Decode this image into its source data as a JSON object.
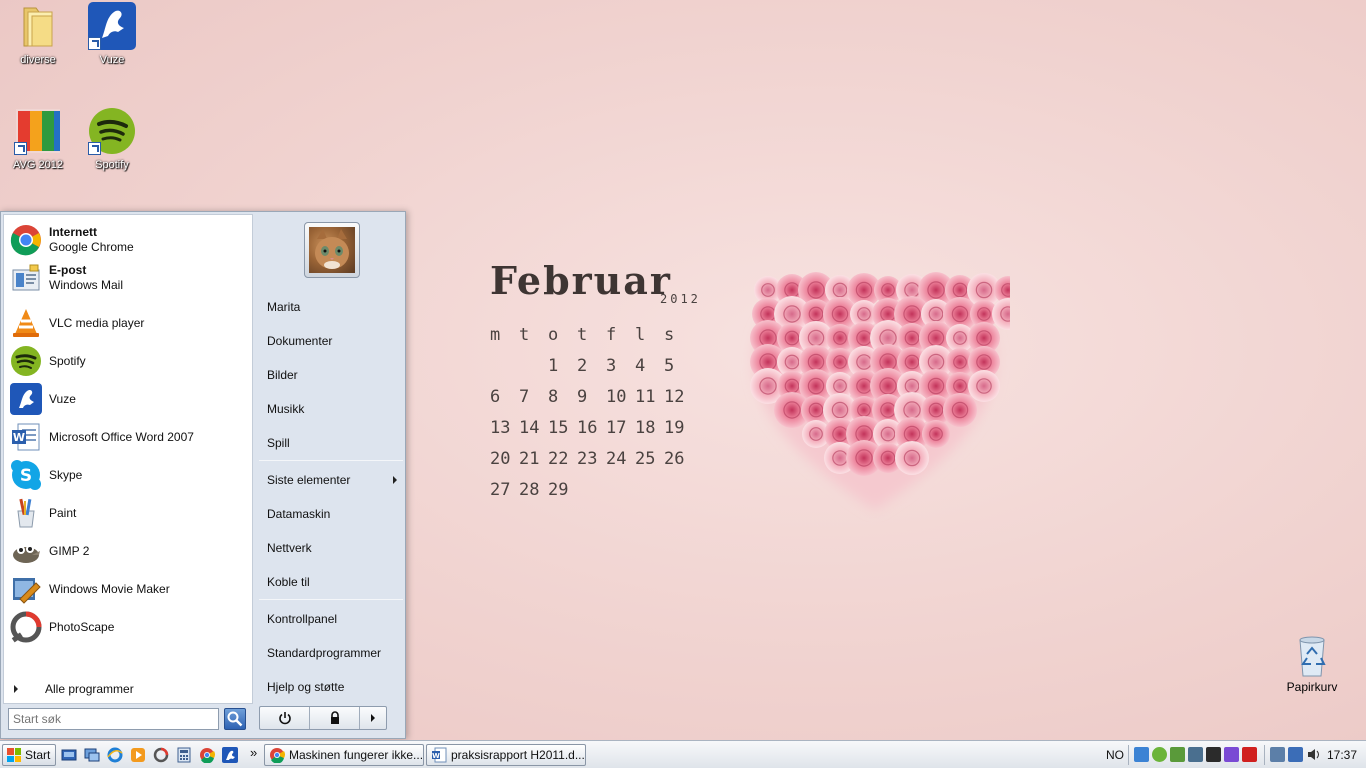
{
  "desktop": {
    "icons": [
      {
        "label": "diverse"
      },
      {
        "label": "Vuze"
      },
      {
        "label": "AVG 2012"
      },
      {
        "label": "Spotify"
      }
    ],
    "recycle_bin": "Papirkurv"
  },
  "wallpaper": {
    "month": "Februar",
    "year": "2012",
    "weekdays": [
      "m",
      "t",
      "o",
      "t",
      "f",
      "l",
      "s"
    ],
    "days": [
      "",
      "",
      "1",
      "2",
      "3",
      "4",
      "5",
      "6",
      "7",
      "8",
      "9",
      "10",
      "11",
      "12",
      "13",
      "14",
      "15",
      "16",
      "17",
      "18",
      "19",
      "20",
      "21",
      "22",
      "23",
      "24",
      "25",
      "26",
      "27",
      "28",
      "29",
      "",
      "",
      "",
      ""
    ]
  },
  "start_menu": {
    "pinned": [
      {
        "title": "Internett",
        "subtitle": "Google Chrome",
        "icon": "chrome-icon"
      },
      {
        "title": "E-post",
        "subtitle": "Windows Mail",
        "icon": "mail-icon"
      }
    ],
    "recent": [
      {
        "label": "VLC media player",
        "icon": "vlc-icon"
      },
      {
        "label": "Spotify",
        "icon": "spotify-icon"
      },
      {
        "label": "Vuze",
        "icon": "vuze-icon"
      },
      {
        "label": "Microsoft Office Word 2007",
        "icon": "word-icon"
      },
      {
        "label": "Skype",
        "icon": "skype-icon"
      },
      {
        "label": "Paint",
        "icon": "paint-icon"
      },
      {
        "label": "GIMP 2",
        "icon": "gimp-icon"
      },
      {
        "label": "Windows Movie Maker",
        "icon": "movie-maker-icon"
      },
      {
        "label": "PhotoScape",
        "icon": "photoscape-icon"
      }
    ],
    "all_programs": "Alle programmer",
    "search_placeholder": "Start søk",
    "right": {
      "group1": [
        "Marita",
        "Dokumenter",
        "Bilder",
        "Musikk",
        "Spill"
      ],
      "group2": [
        "Siste elementer",
        "Datamaskin",
        "Nettverk",
        "Koble til"
      ],
      "group3": [
        "Kontrollpanel",
        "Standardprogrammer",
        "Hjelp og støtte"
      ]
    }
  },
  "taskbar": {
    "start_label": "Start",
    "overflow": "»",
    "tasks": [
      {
        "label": "Maskinen fungerer ikke...",
        "icon": "chrome-icon"
      },
      {
        "label": "praksisrapport H2011.d...",
        "icon": "word-icon"
      }
    ],
    "language": "NO",
    "clock": "17:37"
  },
  "colors": {
    "wallpaper": "#f0d2cf",
    "start_menu_bg": "#dde4ee",
    "taskbar": "#e9edf2"
  }
}
